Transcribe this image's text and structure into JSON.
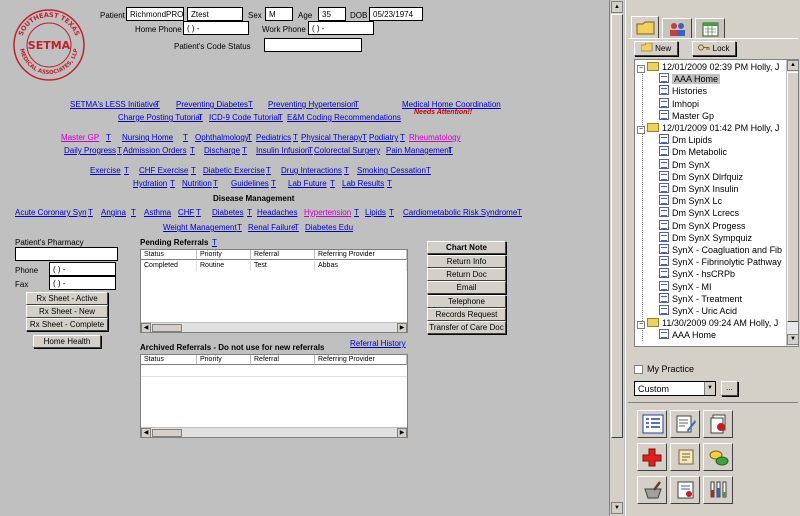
{
  "logo": {
    "text_top": "SOUTHEAST TEXAS",
    "text_center": "SETMA",
    "text_bottom": "MEDICAL ASSOCIATES, LLP"
  },
  "patient": {
    "patient_label": "Patient",
    "last_name": "RichmondPRO(",
    "first_name": "Ztest",
    "sex_label": "Sex",
    "sex": "M",
    "age_label": "Age",
    "age": "35",
    "dob_label": "DOB",
    "dob": "05/23/1974",
    "home_phone_label": "Home Phone",
    "home_phone": "(   )     -",
    "work_phone_label": "Work Phone",
    "work_phone": "(   )     -",
    "code_status_label": "Patient's Code Status",
    "code_status": ""
  },
  "links": {
    "r1": {
      "less": "SETMA's LESS Initiative",
      "diab": "Preventing Diabetes",
      "hyp": "Preventing Hypertension",
      "mhc": "Medical Home Coordination",
      "needs": "Needs Attention!!"
    },
    "r2": {
      "charge": "Charge Posting Tutorial",
      "icd": "ICD-9 Code Tutorial",
      "em": "E&M Coding Recommendations"
    },
    "r3": {
      "mastergp": "Master GP",
      "nursing": "Nursing Home",
      "ophth": "Ophthalmology",
      "peds": "Pediatrics",
      "pt": "Physical Therapy",
      "pod": "Podiatry",
      "rheum": "Rheumatology"
    },
    "r4": {
      "daily": "Daily Progress",
      "admission": "Admission Orders",
      "discharge": "Discharge",
      "insulin": "Insulin Infusion",
      "colorectal": "Colorectal Surgery",
      "pain": "Pain Management"
    },
    "r5": {
      "exercise": "Exercise",
      "chfex": "CHF Exercise",
      "diabex": "Diabetic Exercise",
      "drug": "Drug Interactions",
      "smoking": "Smoking Cessation"
    },
    "r6": {
      "hydration": "Hydration",
      "nutrition": "Nutrition",
      "guidelines": "Guidelines",
      "labfuture": "Lab Future",
      "labresults": "Lab Results"
    },
    "dm_title": "Disease Management",
    "r7": {
      "acs": "Acute Coronary Syn",
      "angina": "Angina",
      "asthma": "Asthma",
      "chf": "CHF",
      "diabetes": "Diabetes",
      "headaches": "Headaches",
      "hypertension": "Hypertension",
      "lipids": "Lipids",
      "cardio": "Cardiometabolic Risk Syndrome"
    },
    "r8": {
      "weight": "Weight Management",
      "renal": "Renal Failure",
      "diabedu": "Diabetes Edu"
    },
    "t": "T"
  },
  "pharmacy": {
    "label": "Patient's Pharmacy",
    "value": "",
    "phone_label": "Phone",
    "phone": "(   )     -",
    "fax_label": "Fax",
    "fax": "(   )     -",
    "rx_active": "Rx Sheet - Active",
    "rx_new": "Rx Sheet - New",
    "rx_complete": "Rx Sheet - Complete",
    "home_health": "Home Health"
  },
  "pending": {
    "title": "Pending Referrals",
    "headers": [
      "Status",
      "Priority",
      "Referral",
      "Referring Provider"
    ],
    "rows": [
      [
        "Completed",
        "Routine",
        "Test",
        "Abbas"
      ]
    ]
  },
  "archived": {
    "title": "Archived Referrals - Do not use for new referrals",
    "history_link": "Referral History",
    "headers": [
      "Status",
      "Priority",
      "Referral",
      "Referring Provider"
    ]
  },
  "actions": {
    "chart_note": "Chart Note",
    "return_info": "Return Info",
    "return_doc": "Return Doc",
    "email": "Email",
    "telephone": "Telephone",
    "records": "Records Request",
    "transfer": "Transfer of Care Doc"
  },
  "side": {
    "new": "New",
    "lock": "Lock",
    "tree": [
      {
        "type": "folder",
        "label": "12/01/2009 02:39 PM Holly, J"
      },
      {
        "type": "doc",
        "label": "AAA Home",
        "selected": true
      },
      {
        "type": "doc",
        "label": "Histories"
      },
      {
        "type": "doc",
        "label": "Imhopi"
      },
      {
        "type": "doc",
        "label": "Master Gp"
      },
      {
        "type": "folder",
        "label": "12/01/2009 01:42 PM Holly, J"
      },
      {
        "type": "doc",
        "label": "Dm Lipids"
      },
      {
        "type": "doc",
        "label": "Dm Metabolic"
      },
      {
        "type": "doc",
        "label": "Dm SynX"
      },
      {
        "type": "doc",
        "label": "Dm SynX Dlrfquiz"
      },
      {
        "type": "doc",
        "label": "Dm SynX Insulin"
      },
      {
        "type": "doc",
        "label": "Dm SynX Lc"
      },
      {
        "type": "doc",
        "label": "Dm SynX Lcrecs"
      },
      {
        "type": "doc",
        "label": "Dm SynX Progess"
      },
      {
        "type": "doc",
        "label": "Dm SynX Sympquiz"
      },
      {
        "type": "doc",
        "label": "SynX - Coagluation and Fib"
      },
      {
        "type": "doc",
        "label": "SynX - Fibrinolytic Pathway"
      },
      {
        "type": "doc",
        "label": "SynX - hsCRPb"
      },
      {
        "type": "doc",
        "label": "SynX - MI"
      },
      {
        "type": "doc",
        "label": "SynX - Treatment"
      },
      {
        "type": "doc",
        "label": "SynX - Uric Acid"
      },
      {
        "type": "folder",
        "label": "11/30/2009 09:24 AM Holly, J"
      },
      {
        "type": "doc",
        "label": "AAA Home"
      }
    ],
    "my_practice": "My Practice",
    "custom": "Custom",
    "ellipsis": "..."
  }
}
